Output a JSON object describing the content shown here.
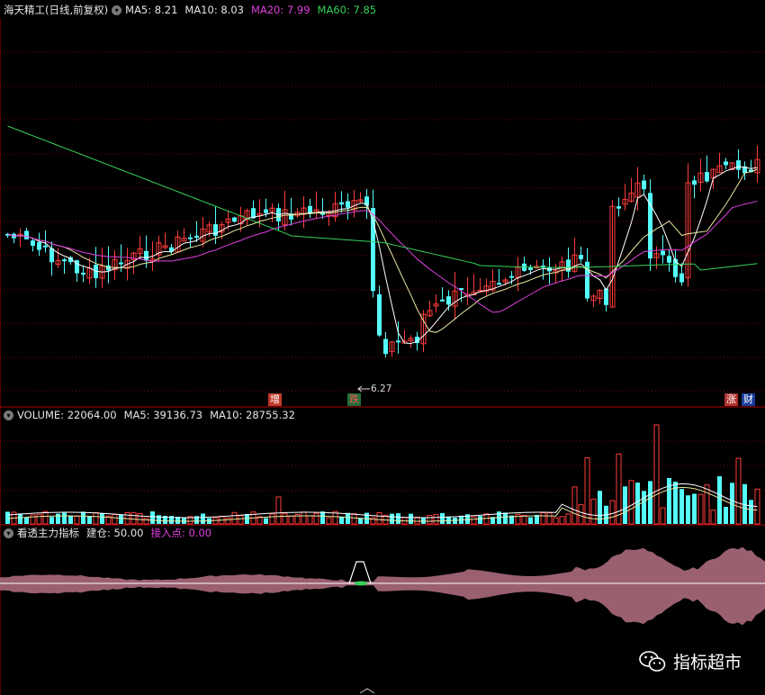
{
  "price_panel": {
    "stock": "海天精工",
    "period": "(日线,前复权)",
    "ma5_label": "MA5:",
    "ma5_value": "8.21",
    "ma10_label": "MA10:",
    "ma10_value": "8.03",
    "ma20_label": "MA20:",
    "ma20_value": "7.99",
    "ma60_label": "MA60:",
    "ma60_value": "7.85",
    "low_marker": "6.27",
    "tag_zeng": "增",
    "tag_die": "跌",
    "tag_zhang": "涨",
    "tag_cai": "财"
  },
  "volume_panel": {
    "label": "VOLUME:",
    "value": "22064.00",
    "ma5_label": "MA5:",
    "ma5_value": "39136.73",
    "ma10_label": "MA10:",
    "ma10_value": "28755.32"
  },
  "indicator_panel": {
    "name": "看透主力指标",
    "jiancang_label": "建仓:",
    "jiancang_value": "50.00",
    "jieru_label": "接入点:",
    "jieru_value": "0.00"
  },
  "watermark": {
    "text": "指标超市"
  },
  "colors": {
    "up": "#ff3c3c",
    "down": "#54fcfc",
    "ma5": "#ffffff",
    "ma10": "#e8e8a0",
    "ma20": "#e040e0",
    "ma60": "#36d05a",
    "grid": "#7a0000",
    "area": "#9a6070"
  }
}
